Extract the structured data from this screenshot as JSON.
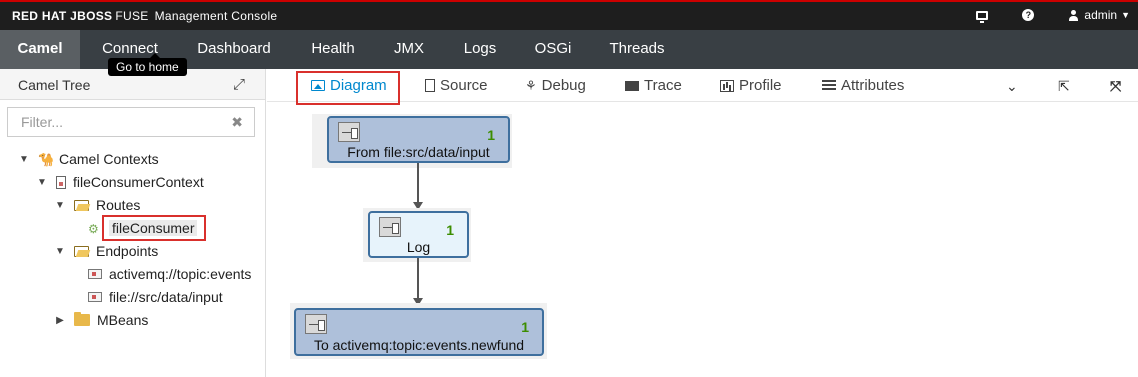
{
  "header": {
    "brand": "RED HAT JBOSS",
    "brand_product": "FUSE",
    "subtitle": "Management Console",
    "user": "admin"
  },
  "nav": {
    "items": [
      "Camel",
      "Connect",
      "Dashboard",
      "Health",
      "JMX",
      "Logs",
      "OSGi",
      "Threads"
    ],
    "active": "Camel",
    "tooltip": "Go to home"
  },
  "left": {
    "title": "Camel Tree",
    "filter_placeholder": "Filter...",
    "tree": {
      "root": "Camel Contexts",
      "context": "fileConsumerContext",
      "routes_folder": "Routes",
      "route": "fileConsumer",
      "endpoints_folder": "Endpoints",
      "endpoints": [
        "activemq://topic:events",
        "file://src/data/input"
      ],
      "mbeans": "MBeans"
    }
  },
  "tabs": {
    "items": [
      "Diagram",
      "Source",
      "Debug",
      "Trace",
      "Profile",
      "Attributes"
    ],
    "active": "Diagram"
  },
  "diagram": {
    "nodes": [
      {
        "label": "From file:src/data/input",
        "count": "1"
      },
      {
        "label": "Log",
        "count": "1"
      },
      {
        "label": "To activemq:topic:events.newfund",
        "count": "1"
      }
    ]
  },
  "colors": {
    "accent": "#0088ce",
    "highlight_box": "#d9302c",
    "node_blue": "#aec0da",
    "node_light": "#e7f3fb",
    "count_green": "#3c8d00"
  }
}
